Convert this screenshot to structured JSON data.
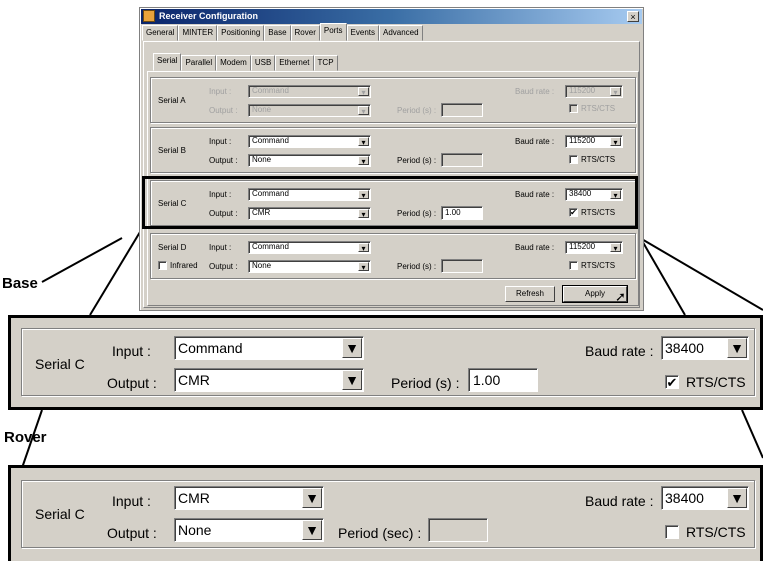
{
  "dialog": {
    "title": "Receiver Configuration",
    "close_label": "×",
    "tabs": [
      "General",
      "MINTER",
      "Positioning",
      "Base",
      "Rover",
      "Ports",
      "Events",
      "Advanced"
    ],
    "active_tab": "Ports",
    "port_tabs": [
      "Serial",
      "Parallel",
      "Modem",
      "USB",
      "Ethernet",
      "TCP"
    ],
    "active_port_tab": "Serial",
    "labels": {
      "input": "Input :",
      "output": "Output :",
      "period": "Period (s) :",
      "baud_rate": "Baud rate :",
      "rts_cts": "RTS/CTS",
      "infrared": "Infrared"
    },
    "ports": [
      {
        "name": "Serial A",
        "input": "Command",
        "output": "None",
        "period": "",
        "baud": "115200",
        "rts": false,
        "enabled": false
      },
      {
        "name": "Serial B",
        "input": "Command",
        "output": "None",
        "period": "",
        "baud": "115200",
        "rts": false,
        "enabled": true
      },
      {
        "name": "Serial C",
        "input": "Command",
        "output": "CMR",
        "period": "1.00",
        "baud": "38400",
        "rts": true,
        "enabled": true
      },
      {
        "name": "Serial D",
        "input": "Command",
        "output": "None",
        "period": "",
        "baud": "115200",
        "rts": false,
        "enabled": true
      }
    ],
    "refresh_label": "Refresh",
    "apply_label": "Apply"
  },
  "callouts": {
    "base": "Base",
    "rover": "Rover"
  },
  "base_panel": {
    "port": "Serial C",
    "input_label": "Input :",
    "input": "Command",
    "output_label": "Output :",
    "output": "CMR",
    "period_label": "Period (s) :",
    "period": "1.00",
    "baud_label": "Baud rate :",
    "baud": "38400",
    "rts_label": "RTS/CTS",
    "rts_checked": true
  },
  "rover_panel": {
    "port": "Serial C",
    "input_label": "Input :",
    "input": "CMR",
    "output_label": "Output :",
    "output": "None",
    "period_label": "Period (sec) :",
    "period": "",
    "baud_label": "Baud rate :",
    "baud": "38400",
    "rts_label": "RTS/CTS",
    "rts_checked": false
  },
  "icons": {
    "dropdown": "chevron-down-icon",
    "check": "checkmark-icon",
    "cursor": "mouse-pointer-icon",
    "app": "app-icon"
  }
}
